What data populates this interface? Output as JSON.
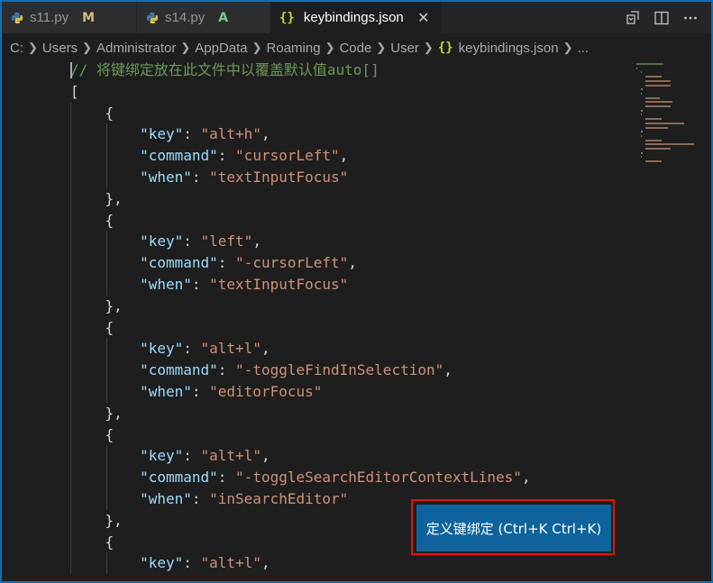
{
  "tabs": [
    {
      "name": "s11.py",
      "status": "M",
      "type": "py",
      "active": false
    },
    {
      "name": "s14.py",
      "status": "A",
      "type": "py",
      "active": false
    },
    {
      "name": "keybindings.json",
      "status": "",
      "type": "json",
      "active": true
    }
  ],
  "icons": {
    "json_glyph": "{}",
    "close_glyph": "✕",
    "split_icon": "split-editor-icon",
    "open_changes_icon": "open-changes-icon",
    "more_icon": "more-actions-icon"
  },
  "breadcrumb": {
    "items": [
      "C:",
      "Users",
      "Administrator",
      "AppData",
      "Roaming",
      "Code",
      "User"
    ],
    "file": "keybindings.json",
    "tail": "..."
  },
  "editor": {
    "current_line": 1,
    "lines": [
      "// 将键绑定放在此文件中以覆盖默认值auto[]",
      "[",
      "    {",
      "        \"key\": \"alt+h\",",
      "        \"command\": \"cursorLeft\",",
      "        \"when\": \"textInputFocus\"",
      "    },",
      "    {",
      "        \"key\": \"left\",",
      "        \"command\": \"-cursorLeft\",",
      "        \"when\": \"textInputFocus\"",
      "    },",
      "    {",
      "        \"key\": \"alt+l\",",
      "        \"command\": \"-toggleFindInSelection\",",
      "        \"when\": \"editorFocus\"",
      "    },",
      "    {",
      "        \"key\": \"alt+l\",",
      "        \"command\": \"-toggleSearchEditorContextLines\",",
      "        \"when\": \"inSearchEditor\"",
      "    },",
      "    {",
      "        \"key\": \"alt+l\","
    ]
  },
  "popup": {
    "label": "定义键绑定 (Ctrl+K Ctrl+K)"
  },
  "colors": {
    "accent_border": "#0e6fb8",
    "popup_bg": "#0e639c",
    "highlight_outline": "#e51400",
    "py_status_m": "#d7ba7d",
    "py_status_a": "#73c991"
  }
}
